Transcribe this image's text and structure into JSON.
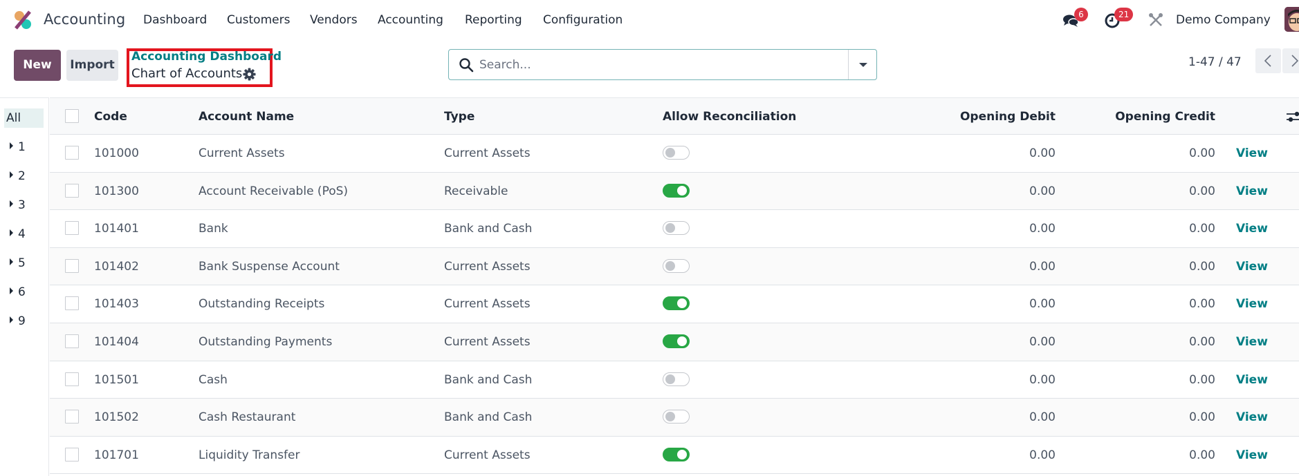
{
  "navbar": {
    "app_name": "Accounting",
    "menu": [
      "Dashboard",
      "Customers",
      "Vendors",
      "Accounting",
      "Reporting",
      "Configuration"
    ],
    "messages_count": "6",
    "activities_count": "21",
    "company": "Demo Company"
  },
  "control_panel": {
    "new_label": "New",
    "import_label": "Import",
    "breadcrumb_parent": "Accounting Dashboard",
    "breadcrumb_current": "Chart of Accounts",
    "search_placeholder": "Search...",
    "search_value": "",
    "pager": "1-47 / 47"
  },
  "sidepanel": {
    "items": [
      "All",
      "1",
      "2",
      "3",
      "4",
      "5",
      "6",
      "9"
    ],
    "active": "All"
  },
  "table": {
    "columns": {
      "code": "Code",
      "name": "Account Name",
      "type": "Type",
      "reconcile": "Allow Reconciliation",
      "debit": "Opening Debit",
      "credit": "Opening Credit"
    },
    "view_label": "View",
    "rows": [
      {
        "code": "101000",
        "name": "Current Assets",
        "type": "Current Assets",
        "reconcile": false,
        "debit": "0.00",
        "credit": "0.00"
      },
      {
        "code": "101300",
        "name": "Account Receivable (PoS)",
        "type": "Receivable",
        "reconcile": true,
        "debit": "0.00",
        "credit": "0.00"
      },
      {
        "code": "101401",
        "name": "Bank",
        "type": "Bank and Cash",
        "reconcile": false,
        "debit": "0.00",
        "credit": "0.00"
      },
      {
        "code": "101402",
        "name": "Bank Suspense Account",
        "type": "Current Assets",
        "reconcile": false,
        "debit": "0.00",
        "credit": "0.00"
      },
      {
        "code": "101403",
        "name": "Outstanding Receipts",
        "type": "Current Assets",
        "reconcile": true,
        "debit": "0.00",
        "credit": "0.00"
      },
      {
        "code": "101404",
        "name": "Outstanding Payments",
        "type": "Current Assets",
        "reconcile": true,
        "debit": "0.00",
        "credit": "0.00"
      },
      {
        "code": "101501",
        "name": "Cash",
        "type": "Bank and Cash",
        "reconcile": false,
        "debit": "0.00",
        "credit": "0.00"
      },
      {
        "code": "101502",
        "name": "Cash Restaurant",
        "type": "Bank and Cash",
        "reconcile": false,
        "debit": "0.00",
        "credit": "0.00"
      },
      {
        "code": "101701",
        "name": "Liquidity Transfer",
        "type": "Current Assets",
        "reconcile": true,
        "debit": "0.00",
        "credit": "0.00"
      }
    ]
  },
  "colors": {
    "brand": "#714b67",
    "link": "#017e84",
    "toggle_on": "#28a745",
    "badge": "#dc3545",
    "highlight_box": "#e3151e"
  }
}
